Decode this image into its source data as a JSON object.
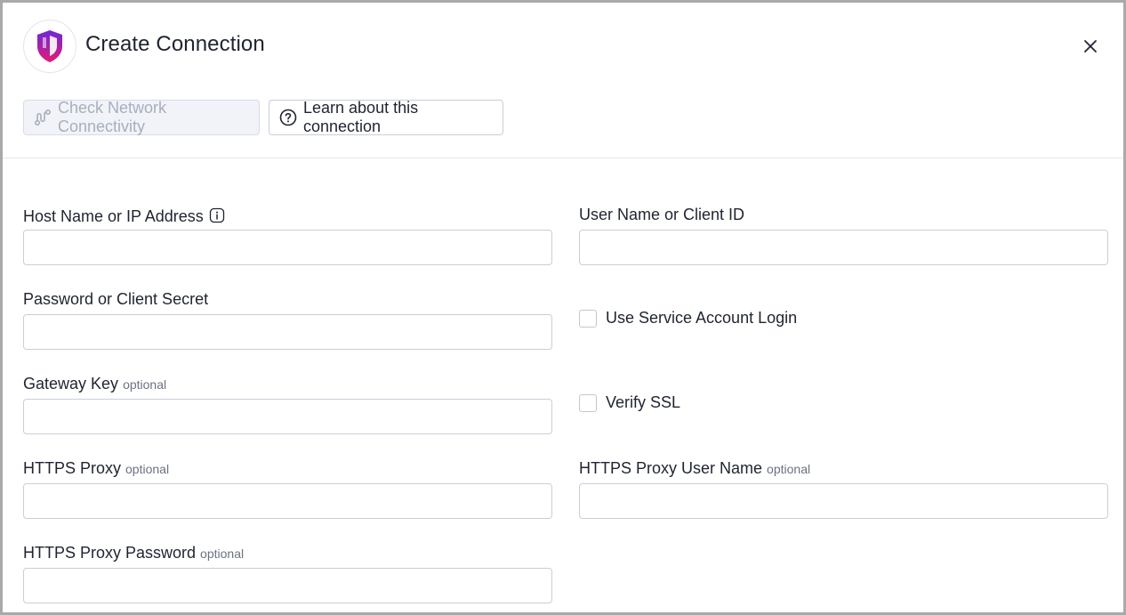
{
  "dialog": {
    "title": "Create Connection",
    "logo_icon": "shield-logo-icon",
    "close_icon": "close-icon",
    "brand_gradient": [
      "#7c3aed",
      "#e11d74"
    ]
  },
  "toolbar": {
    "check_network_label": "Check Network Connectivity",
    "check_network_icon": "route-icon",
    "learn_label": "Learn about this connection",
    "learn_icon": "help-circle-icon"
  },
  "form": {
    "optional_text": "optional",
    "host": {
      "label": "Host Name or IP Address",
      "value": "",
      "info_icon": "info-icon"
    },
    "username": {
      "label": "User Name or Client ID",
      "value": ""
    },
    "password": {
      "label": "Password or Client Secret",
      "value": ""
    },
    "service_account": {
      "label": "Use Service Account Login",
      "checked": false
    },
    "gateway_key": {
      "label": "Gateway Key",
      "value": ""
    },
    "verify_ssl": {
      "label": "Verify SSL",
      "checked": false
    },
    "https_proxy": {
      "label": "HTTPS Proxy",
      "value": ""
    },
    "https_proxy_user": {
      "label": "HTTPS Proxy User Name",
      "value": ""
    },
    "https_proxy_password": {
      "label": "HTTPS Proxy Password",
      "value": ""
    }
  }
}
